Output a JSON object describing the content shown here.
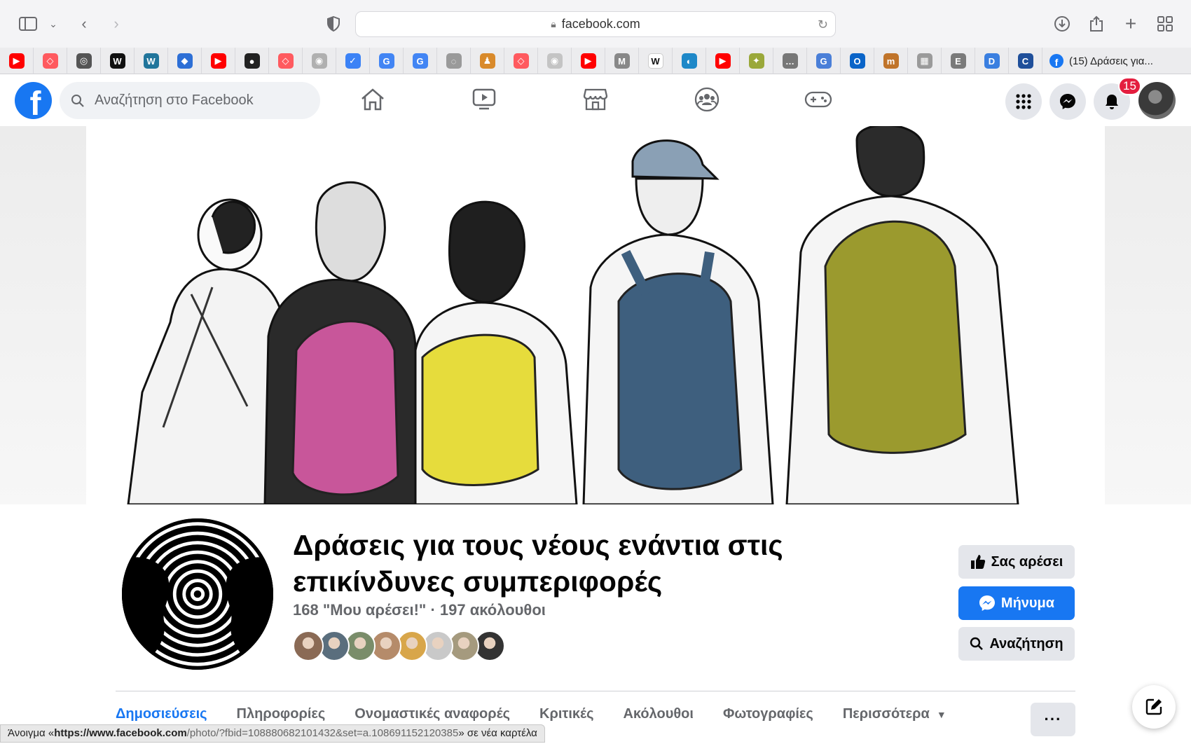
{
  "browser": {
    "url": "facebook.com",
    "active_tab_title": "(15) Δράσεις για...",
    "bookmarks": [
      {
        "icon": "youtube-icon",
        "color": "#ff0000",
        "glyph": "▶"
      },
      {
        "icon": "airbnb-icon",
        "color": "#ff5a5f",
        "glyph": "◇"
      },
      {
        "icon": "globe-icon",
        "color": "#555555",
        "glyph": "◎"
      },
      {
        "icon": "wikipedia-w-icon",
        "color": "#111111",
        "glyph": "W"
      },
      {
        "icon": "wordpress-icon",
        "color": "#21759b",
        "glyph": "W"
      },
      {
        "icon": "map-pin-icon",
        "color": "#2d6fd6",
        "glyph": "◆"
      },
      {
        "icon": "youtube-icon",
        "color": "#ff0000",
        "glyph": "▶"
      },
      {
        "icon": "globe-dark-icon",
        "color": "#222222",
        "glyph": "●"
      },
      {
        "icon": "airbnb-icon",
        "color": "#ff5a5f",
        "glyph": "◇"
      },
      {
        "icon": "seal-icon",
        "color": "#b0b0b0",
        "glyph": "◉"
      },
      {
        "icon": "checkbox-icon",
        "color": "#3b82f6",
        "glyph": "✓"
      },
      {
        "icon": "google-icon",
        "color": "#4285f4",
        "glyph": "G"
      },
      {
        "icon": "google-icon",
        "color": "#4285f4",
        "glyph": "G"
      },
      {
        "icon": "pinterest-icon",
        "color": "#9a9a9a",
        "glyph": "◌"
      },
      {
        "icon": "people-icon",
        "color": "#d98a2b",
        "glyph": "♟"
      },
      {
        "icon": "airbnb-icon",
        "color": "#ff5a5f",
        "glyph": "◇"
      },
      {
        "icon": "seal-icon",
        "color": "#c4c4c4",
        "glyph": "◉"
      },
      {
        "icon": "youtube-icon",
        "color": "#ff0000",
        "glyph": "▶"
      },
      {
        "icon": "medium-icon",
        "color": "#888888",
        "glyph": "M"
      },
      {
        "icon": "wikipedia-icon",
        "color": "#ffffff",
        "glyph": "W"
      },
      {
        "icon": "orbit-icon",
        "color": "#1e88c8",
        "glyph": "◐"
      },
      {
        "icon": "youtube-icon",
        "color": "#ff0000",
        "glyph": "▶"
      },
      {
        "icon": "leaf-icon",
        "color": "#9aa83a",
        "glyph": "✦"
      },
      {
        "icon": "dots-icon",
        "color": "#777777",
        "glyph": "…"
      },
      {
        "icon": "translate-icon",
        "color": "#4a7fd8",
        "glyph": "G"
      },
      {
        "icon": "outlook-icon",
        "color": "#0a64c8",
        "glyph": "O"
      },
      {
        "icon": "graduation-icon",
        "color": "#c0742a",
        "glyph": "m"
      },
      {
        "icon": "building-icon",
        "color": "#9a9a9a",
        "glyph": "▦"
      },
      {
        "icon": "e-icon",
        "color": "#7a7a7a",
        "glyph": "E"
      },
      {
        "icon": "d-icon",
        "color": "#3a7fe0",
        "glyph": "D"
      },
      {
        "icon": "cdc-icon",
        "color": "#1f4f9a",
        "glyph": "C"
      }
    ]
  },
  "header": {
    "search_placeholder": "Αναζήτηση στο Facebook",
    "notification_count": "15"
  },
  "page": {
    "title": "Δράσεις για τους νέους ενάντια στις επικίνδυνες συμπεριφορές",
    "stats": "168 \"Μου αρέσει!\" · 197 ακόλουθοι",
    "friend_avatars": [
      "#8a6a55",
      "#5a6e7d",
      "#7a8d6a",
      "#b58b6a",
      "#d8a64a",
      "#c9c9c9",
      "#a59a7e",
      "#333333"
    ],
    "buttons": {
      "like": "Σας αρέσει",
      "message": "Μήνυμα",
      "search": "Αναζήτηση"
    },
    "tabs": [
      {
        "label": "Δημοσιεύσεις",
        "active": true
      },
      {
        "label": "Πληροφορίες",
        "active": false
      },
      {
        "label": "Ονομαστικές αναφορές",
        "active": false
      },
      {
        "label": "Κριτικές",
        "active": false
      },
      {
        "label": "Ακόλουθοι",
        "active": false
      },
      {
        "label": "Φωτογραφίες",
        "active": false
      },
      {
        "label": "Περισσότερα",
        "active": false
      }
    ],
    "more_dots": "···"
  },
  "status_bar": {
    "prefix": "Άνοιγμα «",
    "url_bold": "https://www.facebook.com",
    "url_rest": "/photo/?fbid=108880682101432&set=a.108691152120385",
    "suffix": "» σε νέα καρτέλα"
  },
  "colors": {
    "brand": "#1877f2",
    "backpack_pink": "#c8569a",
    "backpack_yellow": "#e6dc3c",
    "backpack_blue": "#3e5f7e",
    "backpack_olive": "#9b9a2e",
    "badge": "#e41e3f"
  }
}
